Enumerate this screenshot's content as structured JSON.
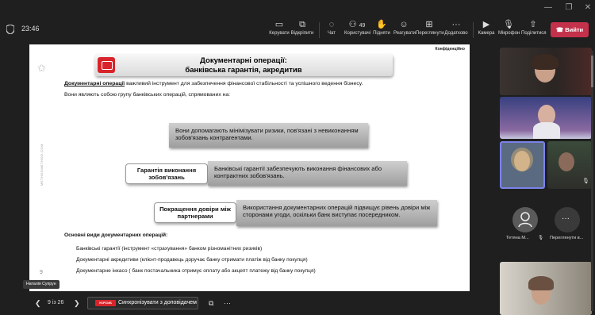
{
  "app": {
    "timer": "23:46"
  },
  "toolbar": {
    "items": [
      {
        "label": "Керувати",
        "icon": "manage-icon"
      },
      {
        "label": "Відкріпити",
        "icon": "unpin-icon"
      },
      {
        "label": "Чат",
        "icon": "chat-icon"
      },
      {
        "label": "Користувачі",
        "icon": "people-icon",
        "count": "49"
      },
      {
        "label": "Підняти",
        "icon": "raise-hand-icon"
      },
      {
        "label": "Реагувати",
        "icon": "react-icon"
      },
      {
        "label": "Переглянути",
        "icon": "view-icon"
      },
      {
        "label": "Додатково",
        "icon": "more-icon"
      },
      {
        "label": "Камера",
        "icon": "camera-icon"
      },
      {
        "label": "Мікрофон",
        "icon": "mic-icon"
      },
      {
        "label": "Поділитися",
        "icon": "share-icon"
      }
    ],
    "leave_label": "Вийти",
    "leave_color": "#c4314b"
  },
  "slide": {
    "confidential": "Конфіденційно",
    "title_line1": "Документарні операції:",
    "title_line2": "банківська гарантія, акредитив",
    "intro_bold": "Документарні операції",
    "intro_rest": "  важливий інструмент для забезпечення фінансової стабільності та успішного ведення бізнесу.",
    "intro2": "Вони являють собою групу банківських операцій, спрямованих на:",
    "box1": "Вони допомагають мінімізувати ризики, пов'язані з невиконанням зобов'язань контрагентами.",
    "label2": "Гарантія виконання зобов'язань",
    "box2": "Банківські гарантії забезпечують виконання фінансових або контрактних зобов'язань.",
    "label3": "Покращення довіри між партнерами",
    "box3": "Використання документарних операцій підвищує рівень довіри між сторонами угоди, оскільки банк виступає посередником.",
    "subtitle": "Основні види документарних операцій:",
    "list": [
      "Банківські гарантії (інструмент «страхування» банком різноманітних ризиків)",
      "Документарні акредитиви (клієнт-продавець доручає банку отримати платіж від банку покупця)",
      "Документарне інкасо ( банк постачальника отримує оплату або акцепт платежу від банку покупця)"
    ],
    "page_number": "9",
    "side_text": "METHODMETHOD.COM",
    "brand_color": "#d8242a"
  },
  "presenter_name": "Наталія Супрун",
  "bottom": {
    "pager": "9 із 26",
    "logo_text": "УКРСИБ",
    "sync_label": "Синхронізувати з доповідачем"
  },
  "participants": {
    "tile1_name": "Тетяна М...",
    "tile2_name": "Переглянути в..."
  }
}
